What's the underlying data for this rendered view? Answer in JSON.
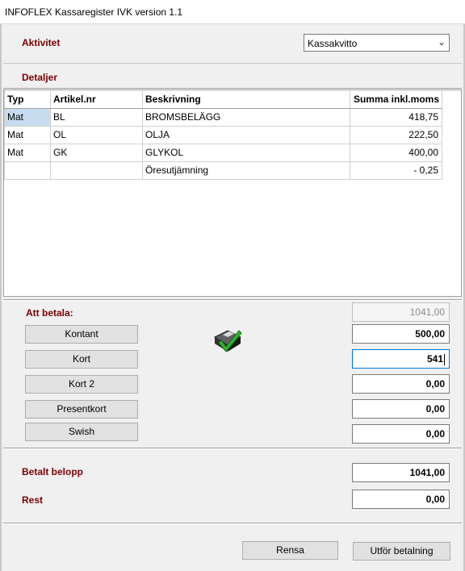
{
  "window": {
    "title": "INFOFLEX Kassaregister IVK version 1.1"
  },
  "activity": {
    "label": "Aktivitet",
    "selected": "Kassakvitto"
  },
  "details": {
    "label": "Detaljer"
  },
  "table": {
    "headers": [
      "Typ",
      "Artikel.nr",
      "Beskrivning",
      "Summa inkl.moms"
    ],
    "rows": [
      [
        "Mat",
        "BL",
        "BROMSBELÄGG",
        "418,75"
      ],
      [
        "Mat",
        "OL",
        "OLJA",
        "222,50"
      ],
      [
        "Mat",
        "GK",
        "GLYKOL",
        "400,00"
      ],
      [
        "",
        "",
        "Öresutjämning",
        "- 0,25"
      ]
    ]
  },
  "payment": {
    "to_pay_label": "Att betala:",
    "to_pay_value": "1041,00",
    "methods": [
      {
        "label": "Kontant",
        "value": "500,00"
      },
      {
        "label": "Kort",
        "value": "541"
      },
      {
        "label": "Kort 2",
        "value": "0,00"
      },
      {
        "label": "Presentkort",
        "value": "0,00"
      },
      {
        "label": "Swish",
        "value": "0,00"
      }
    ]
  },
  "summary": {
    "paid_label": "Betalt belopp",
    "paid_value": "1041,00",
    "rest_label": "Rest",
    "rest_value": "0,00"
  },
  "actions": {
    "clear_label": "Rensa",
    "pay_label": "Utför betalning"
  },
  "icons": {
    "status": "disk-checkmark-icon"
  }
}
